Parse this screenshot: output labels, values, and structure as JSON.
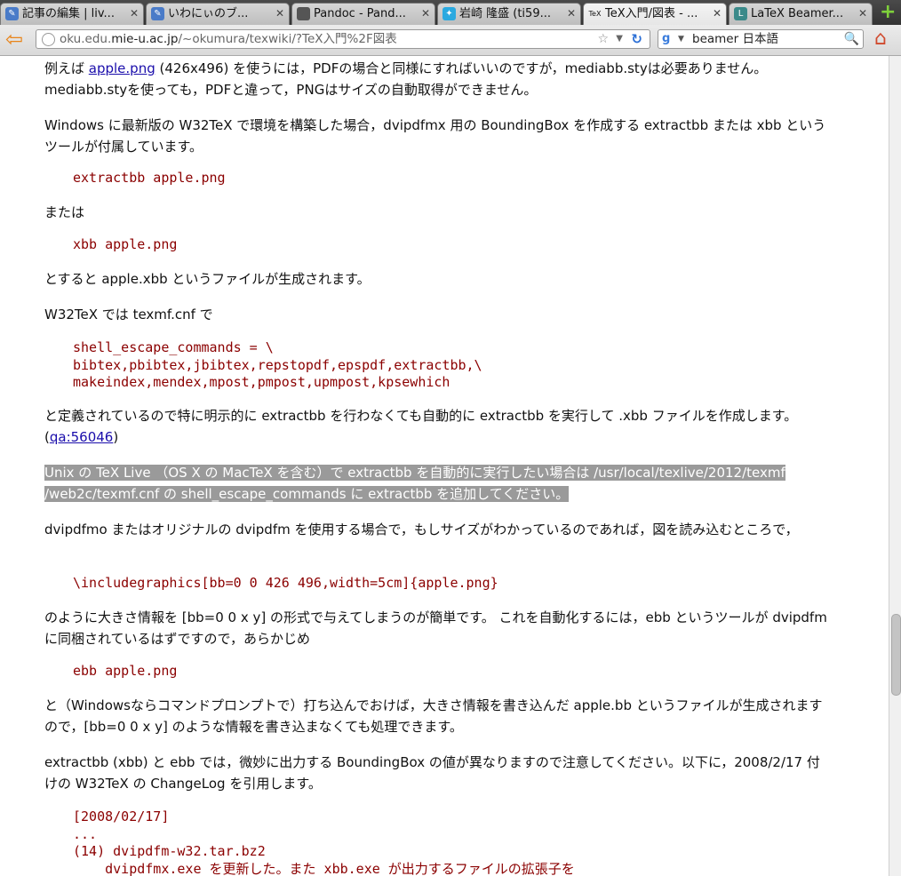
{
  "tabs": [
    {
      "label": "記事の編集 | liv...",
      "favicon": "doc-icon",
      "color": "#4a7bc8"
    },
    {
      "label": "いわにぃのブ...",
      "favicon": "doc-icon",
      "color": "#4a7bc8"
    },
    {
      "label": "Pandoc - Pand...",
      "favicon": "page-icon",
      "color": "#555555"
    },
    {
      "label": "岩崎 隆盛 (ti59...",
      "favicon": "twitter-bird-icon",
      "color": "#2aa9e0"
    },
    {
      "label": "TeX入門/図表 - ...",
      "favicon": "tex-icon",
      "color": "#222222"
    },
    {
      "label": "LaTeX Beamer...",
      "favicon": "page-icon",
      "color": "#3a8a8a"
    }
  ],
  "nav": {
    "url_prefix": "oku.edu.",
    "url_host": "mie-u.ac.jp",
    "url_rest": "/~okumura/texwiki/?TeX入門%2F図表",
    "search_value": "beamer 日本語"
  },
  "content": {
    "p1a": "例えば ",
    "p1_link": "apple.png",
    "p1b": " (426x496) を使うには，PDFの場合と同様にすればいいのですが，mediabb.styは必要ありません。mediabb.styを使っても，PDFと違って，PNGはサイズの自動取得ができません。",
    "p2": "Windows に最新版の W32TeX で環境を構築した場合，dvipdfmx 用の BoundingBox を作成する extractbb または xbb というツールが付属しています。",
    "code1": "extractbb apple.png",
    "p3": "または",
    "code2": "xbb apple.png",
    "p4": "とすると apple.xbb というファイルが生成されます。",
    "p5": "W32TeX では texmf.cnf で",
    "code3": "shell_escape_commands = \\\nbibtex,pbibtex,jbibtex,repstopdf,epspdf,extractbb,\\\nmakeindex,mendex,mpost,pmpost,upmpost,kpsewhich",
    "p6a": "と定義されているので特に明示的に extractbb を行わなくても自動的に extractbb を実行して .xbb ファイルを作成します。(",
    "p6_link": "qa:56046",
    "p6b": ")",
    "p7_line1": "Unix の TeX Live （OS X の MacTeX を含む）で extractbb を自動的に実行したい場合は /usr/local/texlive/2012/texmf",
    "p7_line2": "/web2c/texmf.cnf の shell_escape_commands に extractbb を追加してください。",
    "p8": "dvipdfmo またはオリジナルの dvipdfm を使用する場合で，もしサイズがわかっているのであれば，図を読み込むところで，",
    "code4": "\\includegraphics[bb=0 0 426 496,width=5cm]{apple.png}",
    "p9": "のように大きさ情報を [bb=0 0 x y] の形式で与えてしまうのが簡単です。 これを自動化するには，ebb というツールが dvipdfm に同梱されているはずですので，あらかじめ",
    "code5": "ebb apple.png",
    "p10": "と（Windowsならコマンドプロンプトで）打ち込んでおけば，大きさ情報を書き込んだ apple.bb というファイルが生成されますので，[bb=0 0 x y] のような情報を書き込まなくても処理できます。",
    "p11": "extractbb (xbb) と ebb では，微妙に出力する BoundingBox の値が異なりますので注意してください。以下に，2008/2/17 付けの W32TeX の ChangeLog を引用します。",
    "code6": "[2008/02/17]\n...\n(14) dvipdfm-w32.tar.bz2\n    dvipdfmx.exe を更新した。また xbb.exe が出力するファイルの拡張子を"
  }
}
